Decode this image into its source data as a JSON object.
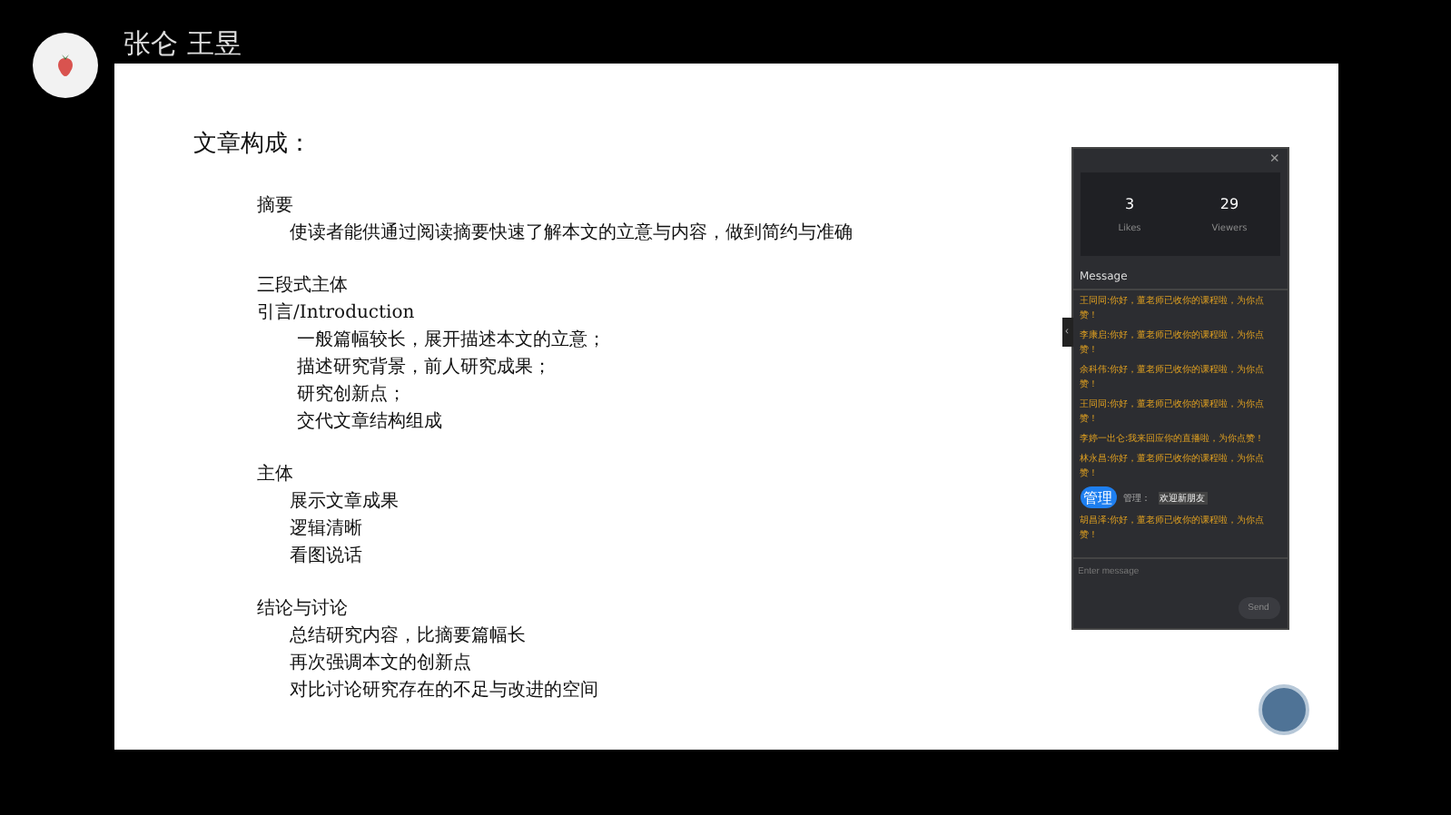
{
  "presenter": {
    "name": "张仑 王昱"
  },
  "slide": {
    "title": "文章构成：",
    "sections": [
      {
        "heading": "摘要",
        "lines": [
          "使读者能供通过阅读摘要快速了解本文的立意与内容，做到简约与准确"
        ]
      },
      {
        "heading": "三段式主体",
        "subheading": "引言/Introduction",
        "lines": [
          "一般篇幅较长，展开描述本文的立意；",
          "描述研究背景，前人研究成果；",
          "研究创新点；",
          "交代文章结构组成"
        ]
      },
      {
        "heading": "主体",
        "lines": [
          "展示文章成果",
          "逻辑清晰",
          "看图说话"
        ]
      },
      {
        "heading": "结论与讨论",
        "lines": [
          "总结研究内容，比摘要篇幅长",
          "再次强调本文的创新点",
          "对比讨论研究存在的不足与改进的空间"
        ]
      }
    ]
  },
  "chat": {
    "close": "×",
    "stats": [
      {
        "value": "3",
        "label": "Likes"
      },
      {
        "value": "29",
        "label": "Viewers"
      }
    ],
    "heading": "Message",
    "collapse": "‹",
    "messages": [
      {
        "kind": "like",
        "text": "王同同:你好，董老师已收你的课程啦，为你点赞！"
      },
      {
        "kind": "like",
        "text": "李康启:你好，董老师已收你的课程啦，为你点赞！"
      },
      {
        "kind": "like",
        "text": "余科伟:你好，董老师已收你的课程啦，为你点赞！"
      },
      {
        "kind": "like",
        "text": "王同同:你好，董老师已收你的课程啦，为你点赞！"
      },
      {
        "kind": "like",
        "text": "李婷一出仑:我来回应你的直播啦，为你点赞！"
      },
      {
        "kind": "like",
        "text": "林永昌:你好，董老师已收你的课程啦，为你点赞！"
      },
      {
        "kind": "notice",
        "badge": "管理",
        "text": "管理：",
        "body": "欢迎新朋友"
      },
      {
        "kind": "like",
        "text": "胡昌泽:你好，董老师已收你的课程啦，为你点赞！"
      }
    ],
    "input": {
      "placeholder": "Enter message"
    },
    "send": "Send"
  }
}
